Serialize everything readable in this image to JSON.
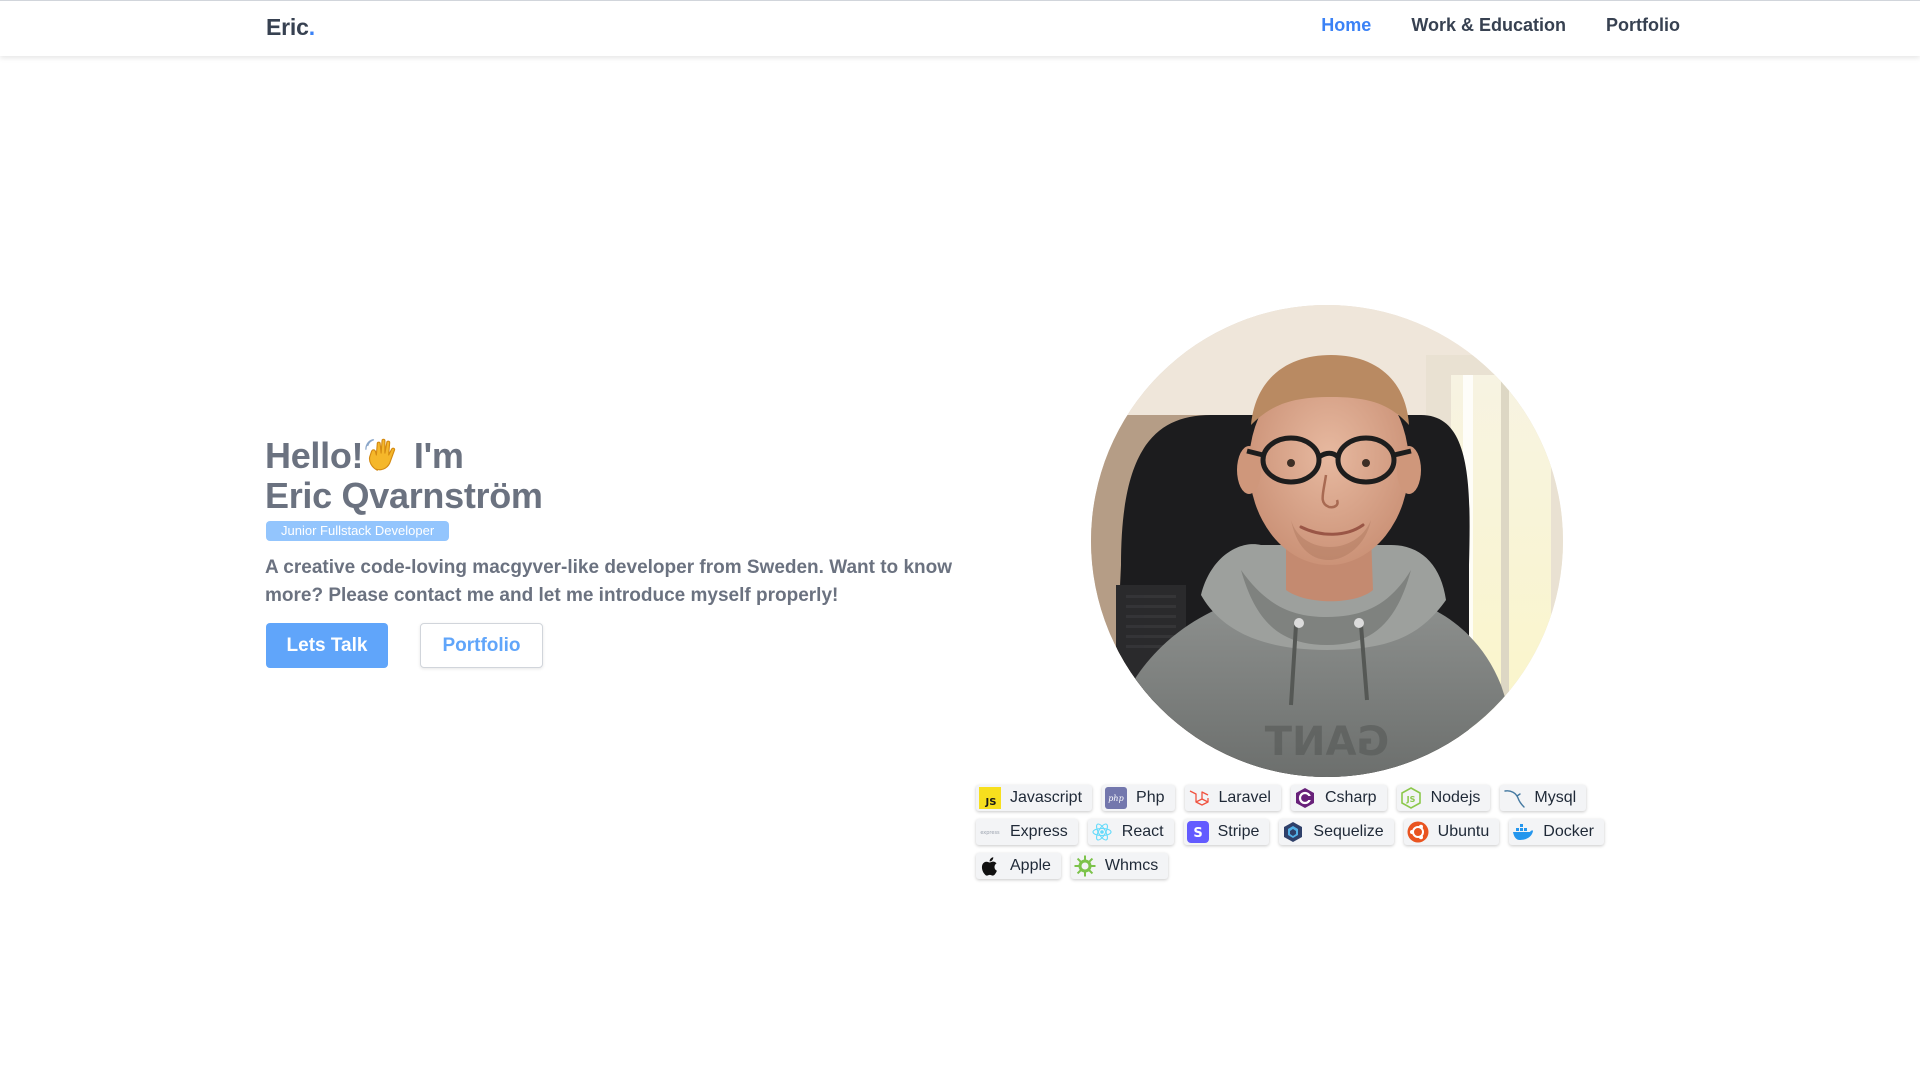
{
  "nav": {
    "brand": "Eric",
    "brand_dot": ".",
    "links": [
      {
        "label": "Home",
        "active": true
      },
      {
        "label": "Work & Education",
        "active": false
      },
      {
        "label": "Portfolio",
        "active": false
      }
    ]
  },
  "hero": {
    "greeting": "Hello!",
    "greeting_emoji": "waving-hand-icon",
    "im": "I'm",
    "name": "Eric Qvarnström",
    "role": "Junior Fullstack Developer",
    "description": "A creative code-loving macgyver-like developer from Sweden. Want to know more? Please contact me and let me introduce myself properly!",
    "primary_button": "Lets Talk",
    "secondary_button": "Portfolio"
  },
  "photo": {
    "alt_icon": "profile-photo"
  },
  "skills": [
    {
      "label": "Javascript",
      "icon": "javascript-icon"
    },
    {
      "label": "Php",
      "icon": "php-icon"
    },
    {
      "label": "Laravel",
      "icon": "laravel-icon"
    },
    {
      "label": "Csharp",
      "icon": "csharp-icon"
    },
    {
      "label": "Nodejs",
      "icon": "nodejs-icon"
    },
    {
      "label": "Mysql",
      "icon": "mysql-icon"
    },
    {
      "label": "Express",
      "icon": "express-icon"
    },
    {
      "label": "React",
      "icon": "react-icon"
    },
    {
      "label": "Stripe",
      "icon": "stripe-icon"
    },
    {
      "label": "Sequelize",
      "icon": "sequelize-icon"
    },
    {
      "label": "Ubuntu",
      "icon": "ubuntu-icon"
    },
    {
      "label": "Docker",
      "icon": "docker-icon"
    },
    {
      "label": "Apple",
      "icon": "apple-icon"
    },
    {
      "label": "Whmcs",
      "icon": "whmcs-icon"
    }
  ],
  "colors": {
    "accent": "#3b82f6",
    "button_primary": "#60a5fa",
    "badge": "#93c5fd",
    "text": "#6b7280"
  }
}
